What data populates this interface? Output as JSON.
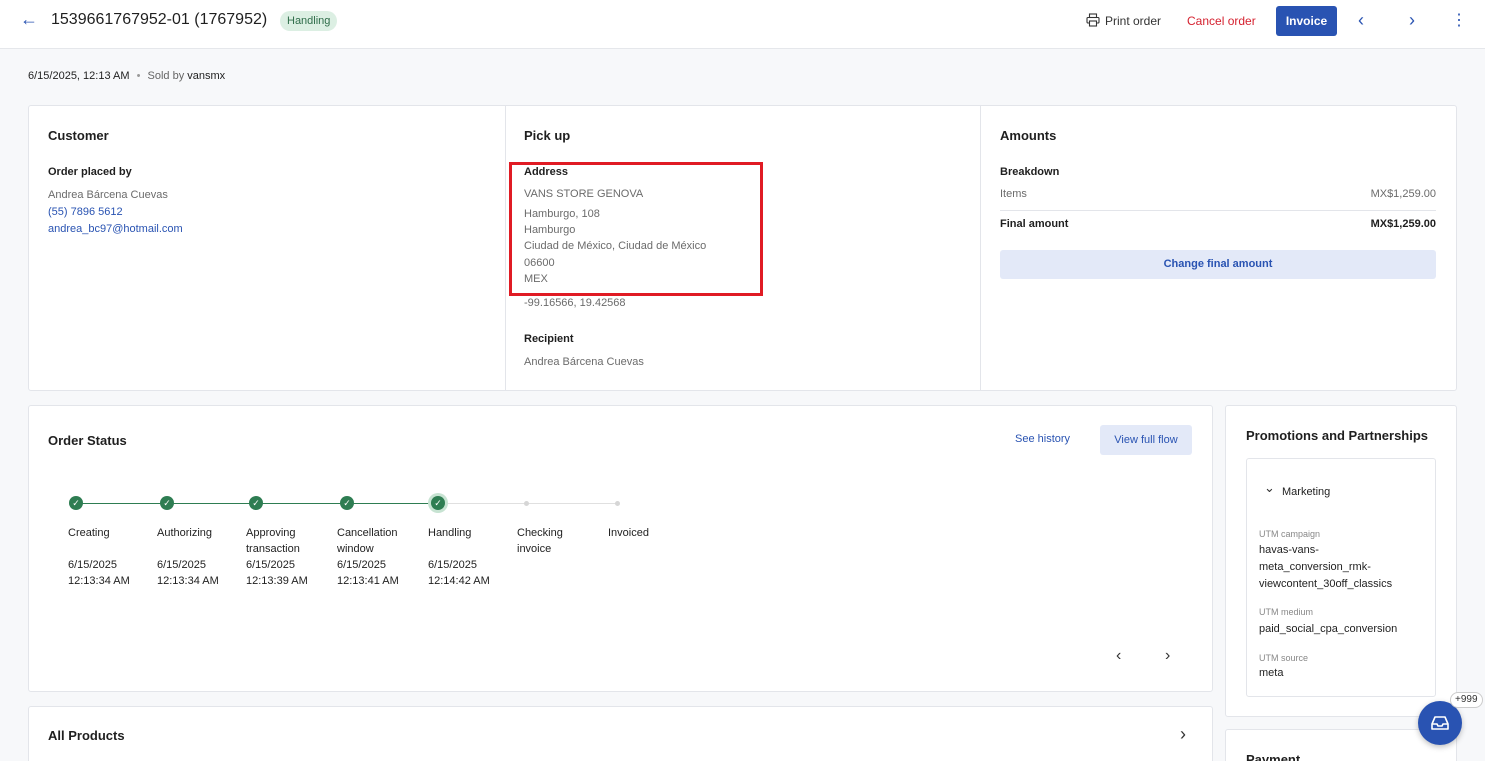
{
  "header": {
    "back_icon": "←",
    "order_id": "1539661767952-01 (1767952)",
    "status_badge": "Handling",
    "print_label": "Print order",
    "cancel_label": "Cancel order",
    "invoice_label": "Invoice",
    "prev_icon": "‹",
    "next_icon": "›",
    "more_icon": "⋮"
  },
  "meta": {
    "datetime": "6/15/2025, 12:13 AM",
    "dot": "•",
    "sold_by_label": "Sold by",
    "seller": "vansmx"
  },
  "customer": {
    "title": "Customer",
    "placed_by_label": "Order placed by",
    "name": "Andrea Bárcena Cuevas",
    "phone": "(55) 7896 5612",
    "email": "andrea_bc97@hotmail.com"
  },
  "pickup": {
    "title": "Pick up",
    "address_label": "Address",
    "store": "VANS STORE GENOVA",
    "street": "Hamburgo, 108",
    "neighborhood": "Hamburgo",
    "city": "Ciudad de México, Ciudad de México",
    "postal": "06600",
    "country": "MEX",
    "coords": "-99.16566, 19.42568",
    "recipient_label": "Recipient",
    "recipient": "Andrea Bárcena Cuevas"
  },
  "amounts": {
    "title": "Amounts",
    "breakdown_label": "Breakdown",
    "items_label": "Items",
    "items_value": "MX$1,259.00",
    "final_label": "Final amount",
    "final_value": "MX$1,259.00",
    "change_button": "Change final amount"
  },
  "order_status": {
    "title": "Order Status",
    "see_history": "See history",
    "view_flow": "View full flow",
    "check": "✓",
    "steps": [
      {
        "label_1": "Creating",
        "label_2": "",
        "date": "6/15/2025",
        "time": "12:13:34 AM"
      },
      {
        "label_1": "Authorizing",
        "label_2": "",
        "date": "6/15/2025",
        "time": "12:13:34 AM"
      },
      {
        "label_1": "Approving",
        "label_2": "transaction",
        "date": "6/15/2025",
        "time": "12:13:39 AM"
      },
      {
        "label_1": "Cancellation",
        "label_2": "window",
        "date": "6/15/2025",
        "time": "12:13:41 AM"
      },
      {
        "label_1": "Handling",
        "label_2": "",
        "date": "6/15/2025",
        "time": "12:14:42 AM"
      },
      {
        "label_1": "Checking",
        "label_2": "invoice"
      },
      {
        "label_1": "Invoiced",
        "label_2": ""
      }
    ],
    "prev_icon": "‹",
    "next_icon": "›"
  },
  "promotions": {
    "title": "Promotions and Partnerships",
    "section": "Marketing",
    "chevron": "⌄",
    "utm_campaign_label": "UTM campaign",
    "utm_campaign_1": "havas-vans-",
    "utm_campaign_2": "meta_conversion_rmk-",
    "utm_campaign_3": "viewcontent_30off_classics",
    "utm_medium_label": "UTM medium",
    "utm_medium": "paid_social_cpa_conversion",
    "utm_source_label": "UTM source",
    "utm_source": "meta"
  },
  "products": {
    "title": "All Products",
    "chevron": "›"
  },
  "payment": {
    "title": "Payment"
  },
  "float": {
    "badge": "+999"
  },
  "colors": {
    "primary": "#2953b2",
    "danger": "#d5212f",
    "success": "#2e7d52",
    "highlight": "#e01b24"
  }
}
